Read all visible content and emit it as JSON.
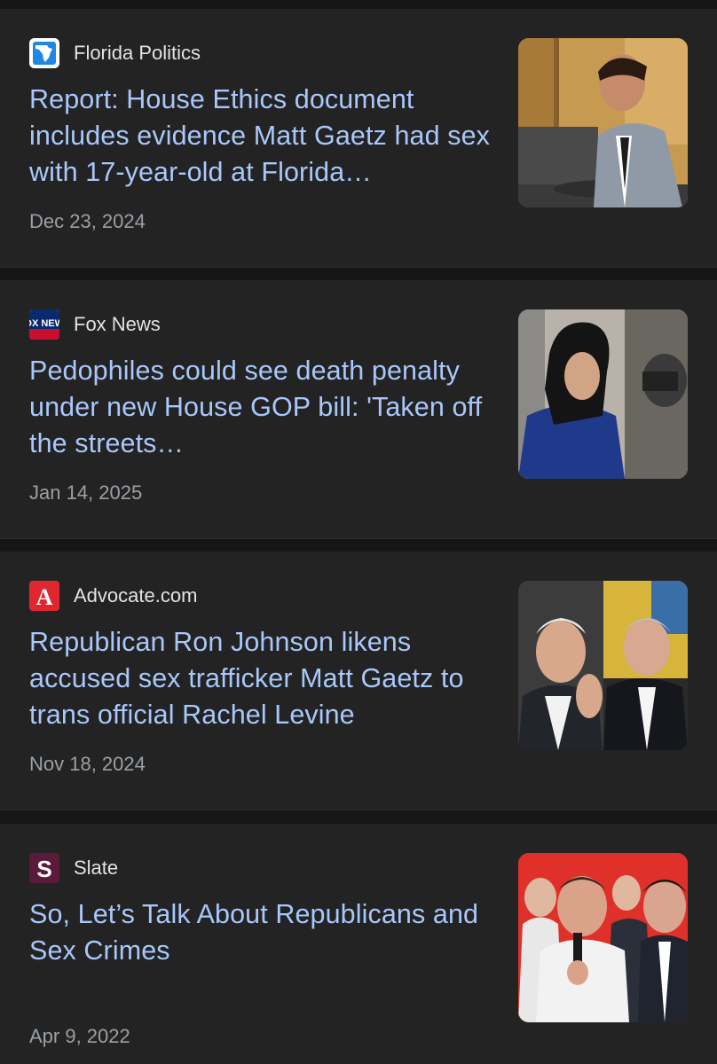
{
  "articles": [
    {
      "source": "Florida Politics",
      "logo_icon": "florida-politics-logo",
      "headline": "Report: House Ethics document includes evidence Matt Gaetz had sex with 17-year-old at Florida…",
      "date": "Dec 23, 2024"
    },
    {
      "source": "Fox News",
      "logo_icon": "fox-news-logo",
      "logo_text": "FOX NEWS",
      "headline": "Pedophiles could see death penalty under new House GOP bill: 'Taken off the streets…",
      "date": "Jan 14, 2025"
    },
    {
      "source": "Advocate.com",
      "logo_icon": "advocate-logo",
      "logo_text": "A",
      "headline": "Republican Ron Johnson likens accused sex trafficker Matt Gaetz to trans official Rachel Levine",
      "date": "Nov 18, 2024"
    },
    {
      "source": "Slate",
      "logo_icon": "slate-logo",
      "logo_text": "S",
      "headline": "So, Let’s Talk About Republicans and Sex Crimes",
      "date": "Apr 9, 2022"
    }
  ],
  "colors": {
    "background": "#161616",
    "card": "#232323",
    "headline": "#a8c7fa",
    "source": "#e3e3e3",
    "date": "#9aa0a6"
  }
}
